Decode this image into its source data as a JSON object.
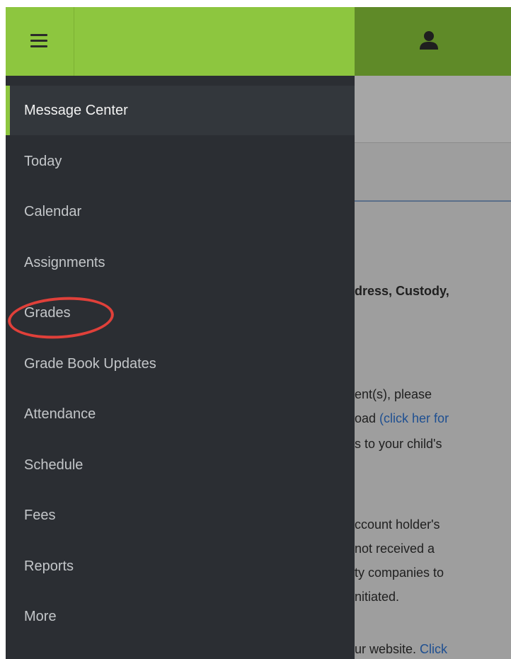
{
  "drawer": {
    "items": [
      {
        "label": "Message Center"
      },
      {
        "label": "Today"
      },
      {
        "label": "Calendar"
      },
      {
        "label": "Assignments"
      },
      {
        "label": "Grades"
      },
      {
        "label": "Grade Book Updates"
      },
      {
        "label": "Attendance"
      },
      {
        "label": "Schedule"
      },
      {
        "label": "Fees"
      },
      {
        "label": "Reports"
      },
      {
        "label": "More"
      }
    ],
    "active_item": "Message Center",
    "highlighted_item": "Grades"
  },
  "background": {
    "lines": [
      "dress, Custody,",
      "ent(s), please",
      "oad ",
      "(click her for",
      "s to your child's",
      "ccount holder's",
      " not received a",
      "ty companies to",
      "nitiated.",
      "ur website.  ",
      "Click"
    ]
  },
  "colors": {
    "accent": "#8dc63f",
    "header_dark": "#5f8a28",
    "drawer_bg": "#2b2e33",
    "highlight_ring": "#e0403a"
  },
  "icons": {
    "menu": "hamburger-menu-icon",
    "user": "user-icon"
  }
}
